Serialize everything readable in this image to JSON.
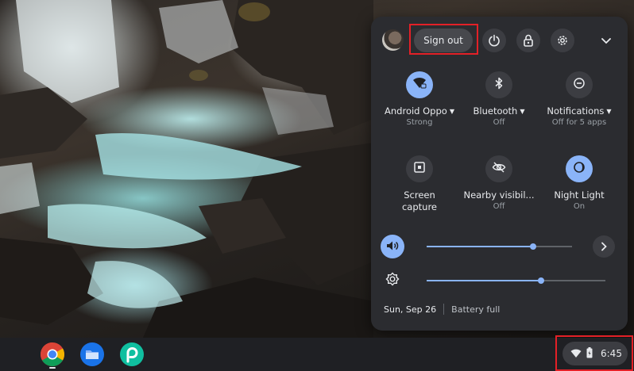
{
  "quick_settings": {
    "sign_out_label": "Sign out",
    "power_icon": "power-icon",
    "lock_icon": "lock-icon",
    "settings_icon": "gear-icon",
    "collapse_icon": "chevron-down-icon",
    "tiles": [
      {
        "label": "Android Oppo",
        "sub": "Strong",
        "icon": "wifi-lock-icon",
        "active": true,
        "has_menu": true
      },
      {
        "label": "Bluetooth",
        "sub": "Off",
        "icon": "bluetooth-icon",
        "active": false,
        "has_menu": true
      },
      {
        "label": "Notifications",
        "sub": "Off for 5 apps",
        "icon": "do-not-disturb-icon",
        "active": false,
        "has_menu": true
      },
      {
        "label": "Screen capture",
        "sub": "",
        "icon": "screen-capture-icon",
        "active": false,
        "has_menu": false
      },
      {
        "label": "Nearby visibil...",
        "sub": "Off",
        "icon": "visibility-off-icon",
        "active": false,
        "has_menu": false
      },
      {
        "label": "Night Light",
        "sub": "On",
        "icon": "night-light-icon",
        "active": true,
        "has_menu": false
      }
    ],
    "volume": {
      "icon": "volume-icon",
      "level": 0.73
    },
    "brightness": {
      "icon": "brightness-icon",
      "level": 0.64
    },
    "date": "Sun, Sep 26",
    "battery": "Battery full"
  },
  "shelf": {
    "apps": [
      "chrome-icon",
      "files-icon",
      "picsart-icon"
    ],
    "time": "6:45",
    "tray_icons": [
      "wifi-icon",
      "battery-icon"
    ]
  },
  "colors": {
    "accent": "#8ab4f8",
    "highlight": "#e32027",
    "panel": "#2b2c30"
  }
}
